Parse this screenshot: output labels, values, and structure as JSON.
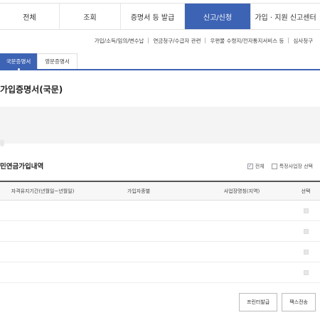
{
  "topnav": {
    "tabs": [
      {
        "label": "전체",
        "active": false
      },
      {
        "label": "조회",
        "active": false
      },
      {
        "label": "증명서 등 발급",
        "active": false
      },
      {
        "label": "신고/신청",
        "active": true
      },
      {
        "label": "가입 · 지원 신고센터",
        "active": false
      }
    ]
  },
  "subnav": {
    "items": [
      "가입/소득/임의/변수납",
      "연금청구/수급자 관련",
      "우편물 수령지/전자통지서비스 등",
      "심사청구"
    ]
  },
  "doctabs": [
    {
      "label": "국문증명서",
      "active": true
    },
    {
      "label": "영문증명서",
      "active": false
    }
  ],
  "section": {
    "title": "가입증명서(국문)"
  },
  "list": {
    "title": "민연금가입내역",
    "filter_all": "전체",
    "filter_all_checked": true,
    "filter_specific": "특정사업장 선택",
    "filter_specific_checked": false
  },
  "table": {
    "headers": [
      "자격유지기간(년월일~년월일)",
      "가입자종별",
      "사업장명칭(지역)",
      "선택"
    ],
    "row_count": 4
  },
  "buttons": {
    "print": "프린터발급",
    "fax": "팩스전송"
  },
  "colors": {
    "accent": "#3d63b4"
  }
}
